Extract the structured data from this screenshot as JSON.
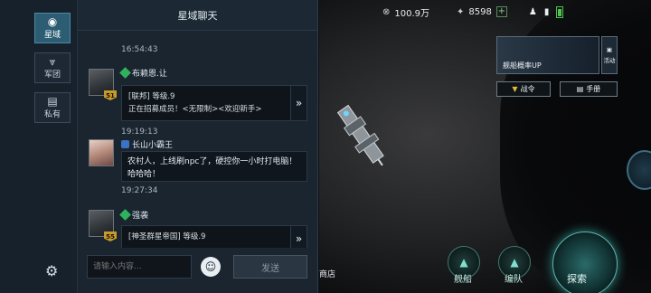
{
  "rail": {
    "items": [
      {
        "label": "星域",
        "icon": "globe-icon",
        "active": true
      },
      {
        "label": "军团",
        "icon": "legion-wings-icon",
        "active": false
      },
      {
        "label": "私有",
        "icon": "private-chat-icon",
        "active": false
      }
    ],
    "settings_icon": "gear-icon"
  },
  "chat": {
    "title": "星域聊天",
    "messages": [
      {
        "time": "16:54:43"
      },
      {
        "name": "布赖恩.让",
        "level": "51",
        "badge": "green",
        "card_title": "[联邦] 等级.9",
        "card_text": "正在招募成员！<无限制><欢迎新手>"
      },
      {
        "time": "19:19:13"
      },
      {
        "name": "长山小霸王",
        "badge": "blue",
        "text": "农村人，上线刷npc了，硬控你一小时打电脑！哈哈哈！"
      },
      {
        "time": "19:27:34"
      },
      {
        "name": "强袭",
        "level": "55",
        "badge": "green",
        "card_title": "[神圣群星帝国] 等级.9"
      }
    ],
    "input_placeholder": "请输入内容...",
    "send_label": "发送",
    "collapse_glyph": "《"
  },
  "hud": {
    "credits": "100.9万",
    "fuel": "8598",
    "promo_label": "舰船概率UP",
    "activity_label": "活动",
    "battle_order_label": "战令",
    "manual_label": "手册",
    "store_label": "商店",
    "nav": [
      {
        "label": "舰船"
      },
      {
        "label": "编队"
      },
      {
        "label": "探索"
      }
    ]
  },
  "colors": {
    "accent_active": "#2c5d73",
    "level_badge": "#c79a2c",
    "battery": "#4ec14e"
  }
}
